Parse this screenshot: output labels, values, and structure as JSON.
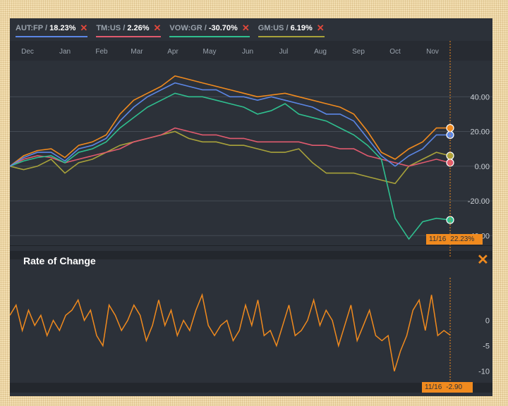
{
  "legend": [
    {
      "ticker": "AUT:FP",
      "value": "18.23%",
      "color": "#5b86e5"
    },
    {
      "ticker": "TM:US",
      "value": "2.26%",
      "color": "#e05a6e"
    },
    {
      "ticker": "VOW:GR",
      "value": "-30.70%",
      "color": "#2fbf8f"
    },
    {
      "ticker": "GM:US",
      "value": "6.19%",
      "color": "#a8a23a"
    }
  ],
  "roc": {
    "title": "Rate of Change"
  },
  "main_badge": {
    "date": "11/16",
    "value": "22.23%"
  },
  "roc_badge": {
    "date": "11/16",
    "value": "-2.90"
  },
  "colors": {
    "orange": "#f08a1e",
    "panel": "#2c3139"
  },
  "chart_data": [
    {
      "type": "line",
      "x_ticks": [
        "Dec",
        "Jan",
        "Feb",
        "Mar",
        "Apr",
        "May",
        "Jun",
        "Jul",
        "Aug",
        "Sep",
        "Oct",
        "Nov"
      ],
      "y_ticks": [
        "40.00",
        "20.00",
        "0.00",
        "-20.00",
        "-40.00"
      ],
      "ylim": [
        -48,
        60
      ],
      "series": [
        {
          "name": "orange",
          "color": "#f08a1e",
          "values": [
            0,
            6,
            9,
            10,
            5,
            12,
            14,
            18,
            30,
            38,
            42,
            46,
            52,
            50,
            48,
            46,
            44,
            42,
            40,
            41,
            42,
            40,
            38,
            36,
            34,
            30,
            20,
            8,
            4,
            10,
            14,
            22,
            22
          ]
        },
        {
          "name": "AUT:FP",
          "color": "#5b86e5",
          "values": [
            0,
            5,
            8,
            8,
            3,
            10,
            12,
            16,
            26,
            34,
            40,
            44,
            48,
            46,
            44,
            44,
            40,
            40,
            38,
            40,
            38,
            36,
            34,
            30,
            30,
            26,
            16,
            6,
            0,
            6,
            10,
            18,
            18
          ]
        },
        {
          "name": "VOW:GR",
          "color": "#2fbf8f",
          "values": [
            0,
            3,
            5,
            6,
            2,
            8,
            10,
            14,
            22,
            28,
            34,
            38,
            42,
            40,
            40,
            38,
            36,
            34,
            30,
            32,
            36,
            30,
            28,
            26,
            22,
            18,
            12,
            4,
            -30,
            -42,
            -32,
            -30,
            -31
          ]
        },
        {
          "name": "TM:US",
          "color": "#e05a6e",
          "values": [
            0,
            4,
            6,
            5,
            2,
            4,
            6,
            8,
            10,
            14,
            16,
            18,
            22,
            20,
            18,
            18,
            16,
            16,
            14,
            14,
            14,
            14,
            12,
            12,
            10,
            10,
            6,
            4,
            2,
            0,
            2,
            4,
            2
          ]
        },
        {
          "name": "GM:US",
          "color": "#a8a23a",
          "values": [
            0,
            -2,
            0,
            4,
            -4,
            2,
            4,
            8,
            12,
            14,
            16,
            18,
            20,
            16,
            14,
            14,
            12,
            12,
            10,
            8,
            8,
            10,
            2,
            -4,
            -4,
            -4,
            -6,
            -8,
            -10,
            0,
            4,
            8,
            6
          ]
        }
      ]
    },
    {
      "type": "line",
      "title": "Rate of Change",
      "y_ticks": [
        "0",
        "-5",
        "-10"
      ],
      "ylim": [
        -12,
        7
      ],
      "series": [
        {
          "color": "#f08a1e",
          "values": [
            1,
            3,
            -2,
            2,
            -1,
            1,
            -3,
            0,
            -2,
            1,
            2,
            4,
            0,
            2,
            -3,
            -5,
            3,
            1,
            -2,
            0,
            3,
            1,
            -4,
            -1,
            4,
            -1,
            2,
            -3,
            0,
            -2,
            2,
            5,
            -1,
            -3,
            -1,
            0,
            -4,
            -2,
            3,
            -1,
            4,
            -3,
            -2,
            -5,
            -1,
            3,
            -3,
            -2,
            0,
            4,
            -1,
            2,
            0,
            -5,
            -1,
            3,
            -4,
            -1,
            2,
            -3,
            -4,
            -3,
            -10,
            -6,
            -3,
            2,
            4,
            -2,
            5,
            -3,
            -2,
            -2.9
          ]
        }
      ]
    }
  ]
}
